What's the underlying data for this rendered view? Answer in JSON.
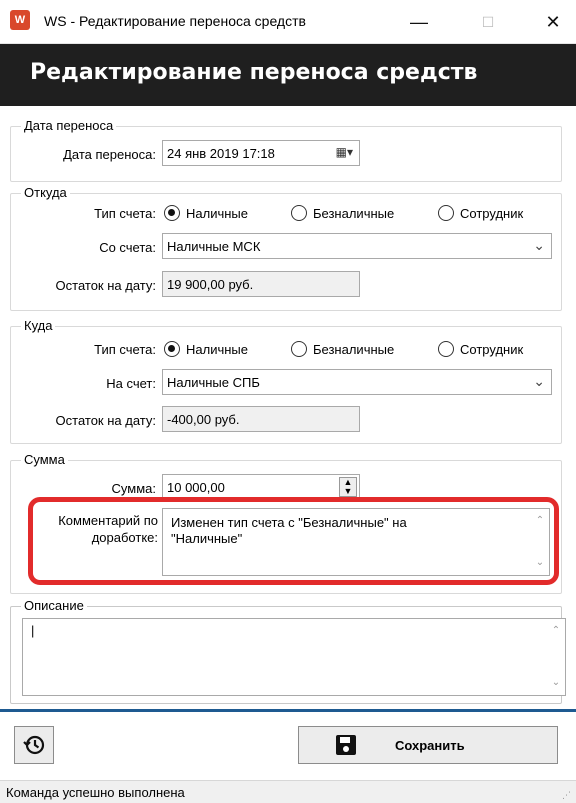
{
  "window": {
    "title": "WS - Редактирование переноса средств",
    "minimize": "—",
    "maximize": "☐",
    "close": "✕"
  },
  "header": {
    "title": "Редактирование переноса средств"
  },
  "transfer_date": {
    "legend": "Дата переноса",
    "label": "Дата переноса:",
    "value": "24 янв  2019  17:18"
  },
  "from": {
    "legend": "Откуда",
    "account_type_label": "Тип счета:",
    "options": [
      "Наличные",
      "Безналичные",
      "Сотрудник"
    ],
    "selected": "Наличные",
    "account_label": "Со счета:",
    "account_value": "Наличные МСК",
    "balance_label": "Остаток на дату:",
    "balance_value": "19 900,00 руб."
  },
  "to": {
    "legend": "Куда",
    "account_type_label": "Тип счета:",
    "options": [
      "Наличные",
      "Безналичные",
      "Сотрудник"
    ],
    "selected": "Наличные",
    "account_label": "На счет:",
    "account_value": "Наличные СПБ",
    "balance_label": "Остаток на дату:",
    "balance_value": "-400,00 руб."
  },
  "amount": {
    "legend": "Сумма",
    "label": "Сумма:",
    "value": "10 000,00"
  },
  "comment": {
    "label_line1": "Комментарий по",
    "label_line2": "доработке:",
    "value_line1": "Изменен тип счета с \"Безналичные\" на",
    "value_line2": "\"Наличные\""
  },
  "description": {
    "legend": "Описание",
    "value": "|"
  },
  "buttons": {
    "save_label": "Сохранить"
  },
  "status": {
    "text": "Команда успешно выполнена"
  },
  "colors": {
    "highlight": "#e22b2b",
    "header_bg": "#1f1f1f",
    "accent_line": "#1e5a91"
  }
}
